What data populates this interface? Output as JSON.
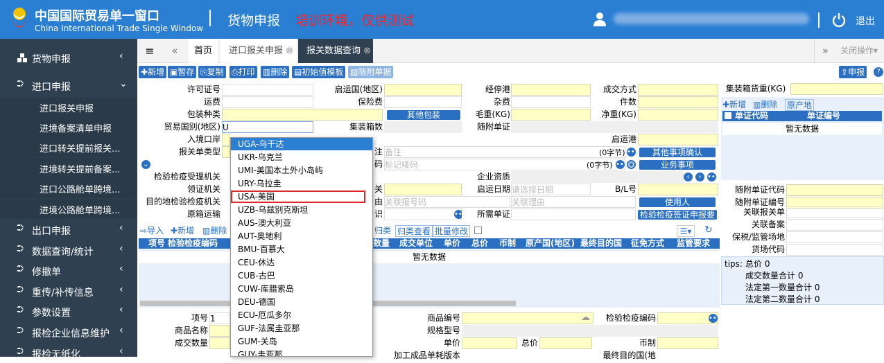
{
  "header": {
    "title_cn": "中国国际贸易单一窗口",
    "title_en": "China International Trade Single Window",
    "module": "货物申报",
    "training_notice": "培训环境，仅供测试",
    "logout": "退出",
    "colors": {
      "bar": "#2b7fd3",
      "notice": "#ff2020"
    }
  },
  "sidebar": {
    "top": {
      "label": "货物申报",
      "arrow": "‹"
    },
    "import": {
      "label": "进口申报",
      "arrow": "⌄"
    },
    "subs": [
      "进口报关申报",
      "进境备案清单申报",
      "进口转关提前报关...",
      "进境转关提前备案...",
      "进口公路舱单跨境...",
      "进境公路舱单跨境..."
    ],
    "groups": [
      {
        "label": "出口申报",
        "arrow": "‹"
      },
      {
        "label": "数据查询/统计",
        "arrow": "‹"
      },
      {
        "label": "修撤单",
        "arrow": "‹"
      },
      {
        "label": "重传/补传信息",
        "arrow": "‹"
      },
      {
        "label": "参数设置",
        "arrow": "‹"
      },
      {
        "label": "报检企业信息维护",
        "arrow": "‹"
      },
      {
        "label": "报检无纸化",
        "arrow": "‹"
      }
    ]
  },
  "tabs": {
    "menu": "≡",
    "prev": "«",
    "next": "»",
    "home": "首页",
    "items": [
      "进口报关申报",
      "报关数据查询"
    ],
    "close_ops": "关闭操作"
  },
  "toolbar": {
    "buttons": [
      "新增",
      "暂存",
      "复制",
      "打印",
      "删除",
      "初始值模板",
      "随附单据"
    ],
    "declare": "申报"
  },
  "form": {
    "labels": {
      "permit": "许可证号",
      "origin_country": "启运国(地区)",
      "via_port": "经停港",
      "deal_mode": "成交方式",
      "freight": "运费",
      "insurance": "保险费",
      "misc": "杂费",
      "pieces": "件数",
      "package": "包装种类",
      "other_package": "其他包装",
      "gross": "毛重(KG)",
      "net": "净重(KG)",
      "trade_country": "贸易国别(地区)",
      "container_count": "集装箱数",
      "attached_cert": "随附单证",
      "entry_port": "入境口岸",
      "dep_port": "启运港",
      "decl_type": "报关单类型",
      "remark_lbl": "注",
      "other_confirm": "其他事项确认",
      "mark_lbl": "码",
      "business": "业务事项",
      "insp_org": "检验检疫受理机关",
      "ent_qual": "企业资质",
      "lead_org": "领证机关",
      "guan": "关",
      "start_date": "启运日期",
      "bl": "B/L号",
      "dest_org": "目的地检验检疫机关",
      "you": "由",
      "user": "使用人",
      "orig_trans": "原箱运输",
      "shi": "识",
      "required_cert": "所需单证",
      "cert_apply": "检验检疫签证申报要",
      "container_weight": "集装箱货重(KG)",
      "attach_code": "随附单证代码",
      "attach_no": "随附单证编号",
      "rel_decl": "关联报关单",
      "rel_record": "关联备案",
      "bonded": "保税/监管场地",
      "yard": "货场代码"
    },
    "trade_country_value": "U",
    "remark_placeholder": "备注",
    "mark_placeholder": "标记唛码",
    "bytes": "(0字节)",
    "date_placeholder": "请选择日期",
    "rel_bill_placeholder": "关联报号码",
    "rel_reason_placeholder": "关联理由"
  },
  "cert_panel": {
    "add": "新增",
    "del": "删除",
    "origin": "原产地",
    "col_code": "单证代码",
    "col_no": "单证编号",
    "empty": "暂无数据"
  },
  "goods": {
    "toolbar": [
      "导入",
      "新增",
      "删除",
      "归类",
      "归类查看",
      "批量修改"
    ],
    "columns_left": [
      "项号",
      "检验检疫编码"
    ],
    "columns_right": [
      "数量",
      "成交单位",
      "单价",
      "总价",
      "币制",
      "原产国(地区)",
      "最终目的国",
      "征免方式",
      "监管要求"
    ],
    "empty": "暂无数据"
  },
  "tips": {
    "label": "tips:",
    "lines": [
      "总价 0",
      "成交数量合计 0",
      "法定第一数量合计 0",
      "法定第二数量合计 0"
    ]
  },
  "detail": {
    "item_no": "项号",
    "item_val": "1",
    "name": "商品名称",
    "qty": "成交数量",
    "code": "商品编号",
    "insp_code": "检验检疫编码",
    "spec": "规格型号",
    "price": "单价",
    "total": "总价",
    "currency": "币制",
    "process": "加工成品单耗版本",
    "final_country": "最终目的国(地"
  },
  "dropdown": {
    "options": [
      "UGA-乌干达",
      "UKR-乌克兰",
      "UMI-美国本土外小岛屿",
      "URY-乌拉圭",
      "USA-美国",
      "UZB-乌兹别克斯坦",
      "AUS-澳大利亚",
      "AUT-奥地利",
      "BMU-百慕大",
      "CEU-休达",
      "CUB-古巴",
      "CUW-库腊索岛",
      "DEU-德国",
      "ECU-厄瓜多尔",
      "GUF-法属圭亚那",
      "GUM-关岛",
      "GUY-圭亚那"
    ],
    "active_index": 0,
    "highlighted_index": 4,
    "colors": {
      "highlight_border": "#e02828",
      "active_bg": "#2b7fd3"
    }
  }
}
